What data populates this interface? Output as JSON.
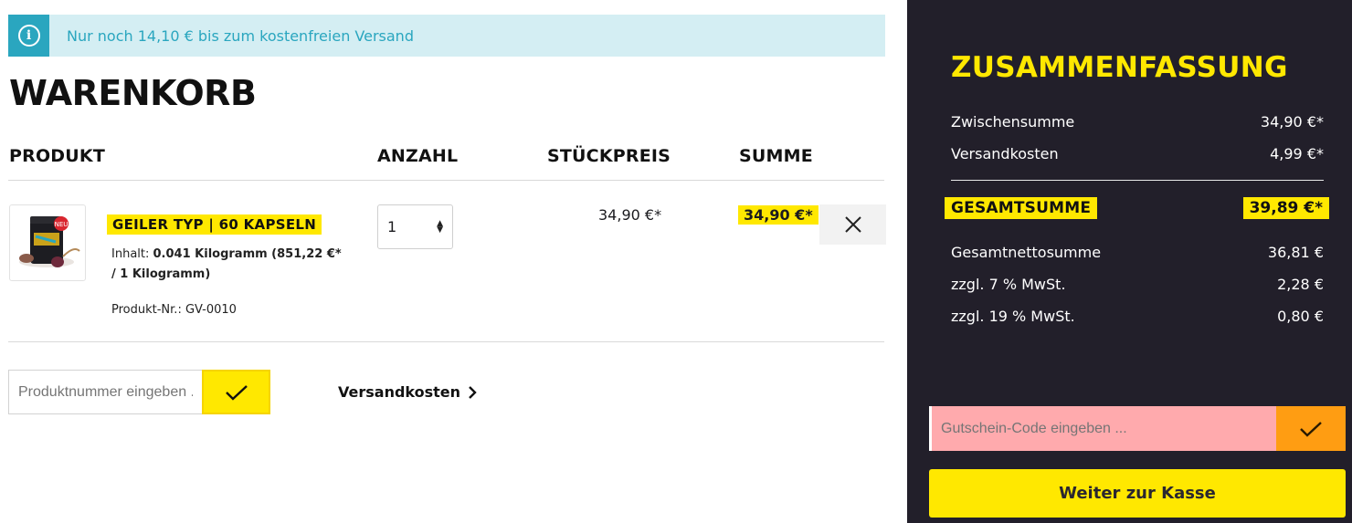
{
  "notice": {
    "text": "Nur noch 14,10 € bis zum kostenfreien Versand",
    "icon": "info-icon"
  },
  "cart": {
    "title": "WARENKORB",
    "columns": {
      "product": "PRODUKT",
      "quantity": "ANZAHL",
      "unit_price": "STÜCKPREIS",
      "total": "SUMME"
    },
    "item": {
      "name": "GEILER TYP | 60 KAPSELN",
      "content_label": "Inhalt:",
      "content_value": "0.041 Kilogramm (851,22 €* / 1 Kilogramm)",
      "product_no": "Produkt-Nr.: GV-0010",
      "quantity": "1",
      "unit_price": "34,90 €*",
      "line_total": "34,90 €*"
    },
    "product_number_input": {
      "placeholder": "Produktnummer eingeben ..."
    },
    "shipping_link": "Versandkosten"
  },
  "summary": {
    "title": "ZUSAMMENFASSUNG",
    "subtotal_label": "Zwischensumme",
    "subtotal_value": "34,90 €*",
    "shipping_label": "Versandkosten",
    "shipping_value": "4,99 €*",
    "grand_total_label": "GESAMTSUMME",
    "grand_total_value": "39,89 €*",
    "net_label": "Gesamtnettosumme",
    "net_value": "36,81 €",
    "vat7_label": "zzgl. 7 % MwSt.",
    "vat7_value": "2,28 €",
    "vat19_label": "zzgl. 19 % MwSt.",
    "vat19_value": "0,80 €",
    "voucher_placeholder": "Gutschein-Code eingeben ...",
    "checkout_label": "Weiter zur Kasse"
  },
  "colors": {
    "accent_yellow": "#ffe800",
    "info_blue": "#2aa6bf",
    "panel_dark": "#221f2a",
    "voucher_error": "#ffaaad",
    "voucher_button": "#ff9d12"
  }
}
